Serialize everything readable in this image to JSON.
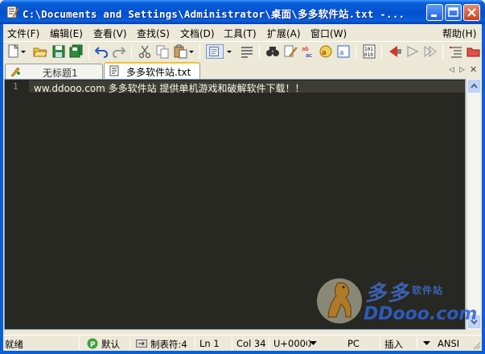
{
  "window": {
    "title": "C:\\Documents and Settings\\Administrator\\桌面\\多多软件站.txt -..."
  },
  "menu": {
    "items": [
      "文件(F)",
      "编辑(E)",
      "查看(V)",
      "查找(S)",
      "文档(D)",
      "工具(T)",
      "扩展(A)",
      "窗口(W)"
    ],
    "help": "帮助(H)"
  },
  "tabs": [
    {
      "label": "无标题1",
      "active": false
    },
    {
      "label": "多多软件站.txt",
      "active": true
    }
  ],
  "editor": {
    "line_number": "1",
    "text": "ww.ddooo.com 多多软件站 提供单机游戏和破解软件下载！！"
  },
  "watermark": {
    "name": "多多",
    "subtitle": "软件站",
    "url": "DDooo.com"
  },
  "status": {
    "state": "就绪",
    "scheme": "默认",
    "tab_size": "制表符:4",
    "line": "Ln 1",
    "col": "Col 34",
    "char_code": "U+0000",
    "line_ending": "PC",
    "mode": "插入",
    "encoding": "ANSI"
  }
}
